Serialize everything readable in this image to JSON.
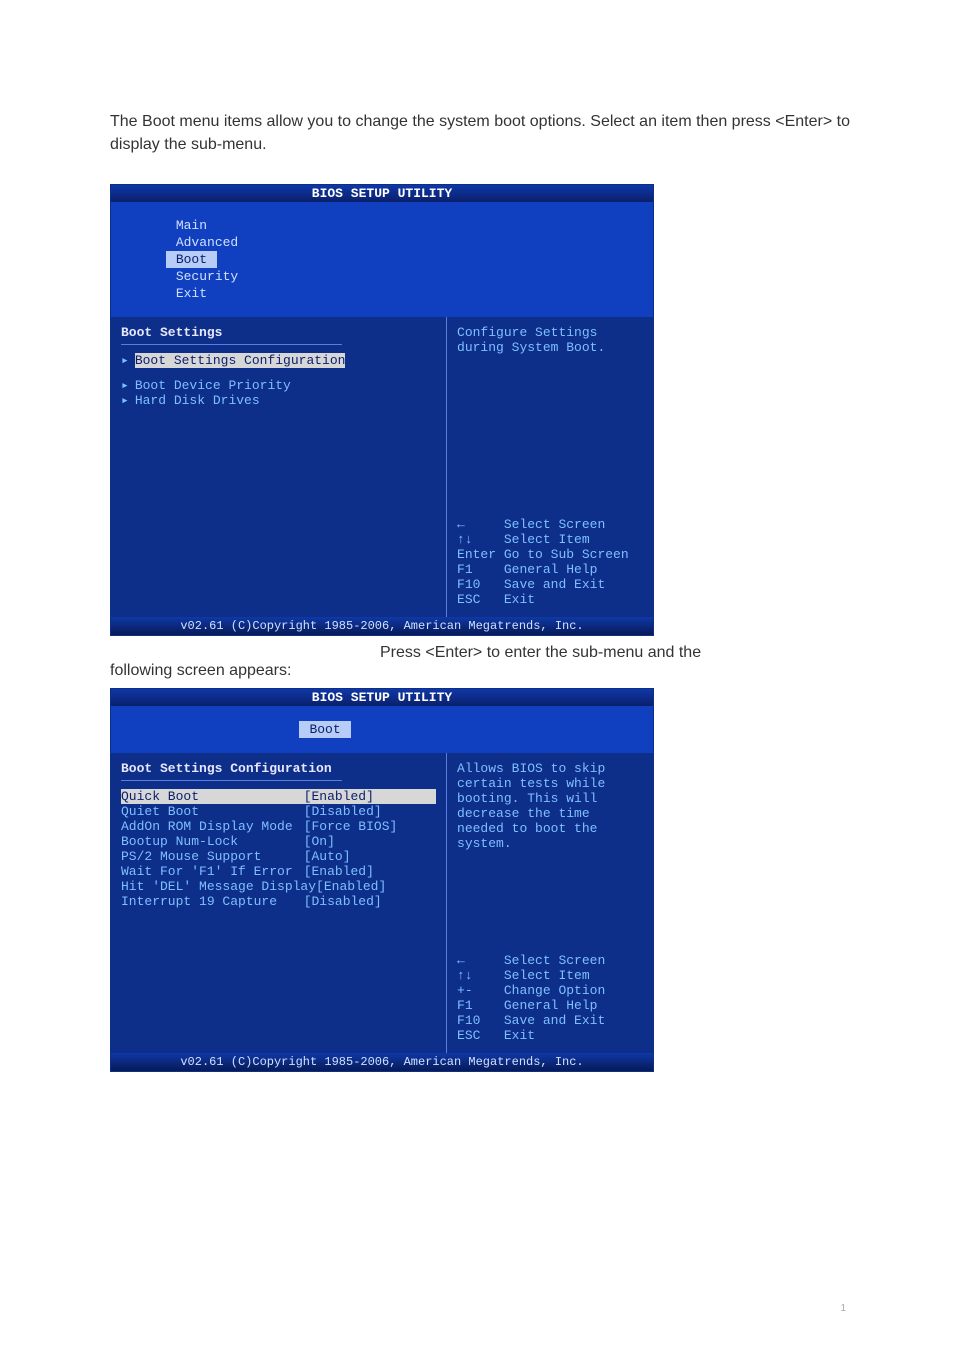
{
  "intro_line": "The Boot menu items allow you to change the system boot options. Select an item then press <Enter> to display the sub-menu.",
  "bios_title": "BIOS SETUP UTILITY",
  "menubar": {
    "tabs": [
      "Main",
      "Advanced",
      "Boot",
      "Security",
      "Exit"
    ],
    "selected": "Boot"
  },
  "screen1": {
    "heading": "Boot Settings",
    "items": [
      "Boot Settings Configuration",
      "Boot Device Priority",
      "Hard Disk Drives"
    ],
    "selected_index": 0,
    "help": "Configure Settings during System Boot.",
    "keys": [
      {
        "k": "←",
        "d": "Select Screen"
      },
      {
        "k": "↑↓",
        "d": "Select Item"
      },
      {
        "k": "Enter",
        "d": "Go to Sub Screen"
      },
      {
        "k": "F1",
        "d": "General Help"
      },
      {
        "k": "F10",
        "d": "Save and Exit"
      },
      {
        "k": "ESC",
        "d": "Exit"
      }
    ]
  },
  "footer": "v02.61 (C)Copyright 1985-2006, American Megatrends, Inc.",
  "mid_text_a": "Press <Enter> to enter the sub-menu and the",
  "mid_text_b": "following screen appears:",
  "screen2": {
    "heading": "Boot Settings Configuration",
    "options": [
      {
        "label": "Quick Boot",
        "value": "[Enabled]",
        "selected": true
      },
      {
        "label": "Quiet Boot",
        "value": "[Disabled]"
      },
      {
        "label": "AddOn ROM Display Mode",
        "value": "[Force BIOS]"
      },
      {
        "label": "Bootup Num-Lock",
        "value": "[On]"
      },
      {
        "label": "PS/2 Mouse Support",
        "value": "[Auto]"
      },
      {
        "label": "Wait For 'F1' If Error",
        "value": "[Enabled]"
      },
      {
        "label": "Hit 'DEL' Message Display",
        "value": "[Enabled]"
      },
      {
        "label": "Interrupt 19 Capture",
        "value": "[Disabled]"
      }
    ],
    "help": "Allows BIOS to skip certain tests while booting. This will decrease the time needed to boot the system.",
    "keys": [
      {
        "k": "←",
        "d": "Select Screen"
      },
      {
        "k": "↑↓",
        "d": "Select Item"
      },
      {
        "k": "+-",
        "d": "Change Option"
      },
      {
        "k": "F1",
        "d": "General Help"
      },
      {
        "k": "F10",
        "d": "Save and Exit"
      },
      {
        "k": "ESC",
        "d": "Exit"
      }
    ]
  },
  "page_number": "1"
}
